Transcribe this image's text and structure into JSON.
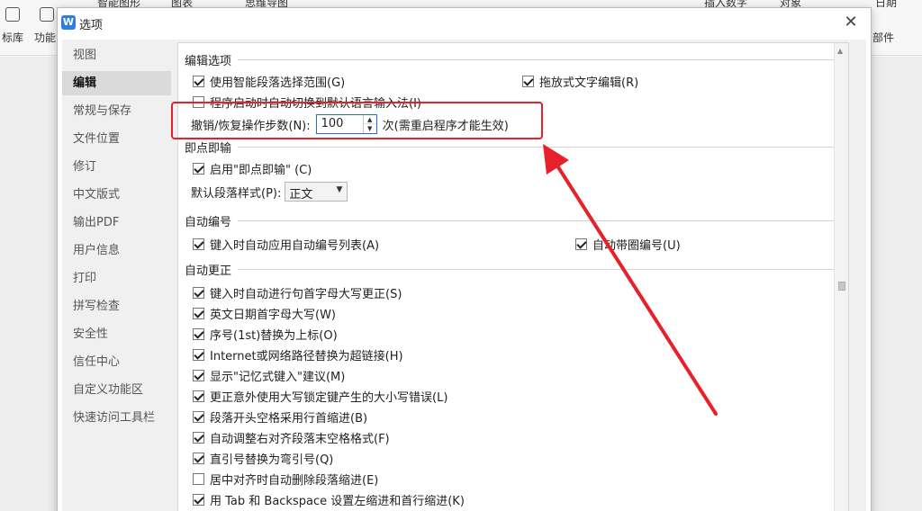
{
  "background": {
    "toolbar_items": [
      "标库",
      "功能",
      "智能图形",
      "图表",
      "思维导图",
      "插入数字",
      "对象",
      "日期",
      "部件"
    ]
  },
  "dialog": {
    "title": "选项",
    "logo_letter": "W",
    "close_symbol": "✕"
  },
  "sidebar": {
    "items": [
      {
        "label": "视图",
        "active": false
      },
      {
        "label": "编辑",
        "active": true
      },
      {
        "label": "常规与保存",
        "active": false
      },
      {
        "label": "文件位置",
        "active": false
      },
      {
        "label": "修订",
        "active": false
      },
      {
        "label": "中文版式",
        "active": false
      },
      {
        "label": "输出PDF",
        "active": false
      },
      {
        "label": "用户信息",
        "active": false
      },
      {
        "label": "打印",
        "active": false
      },
      {
        "label": "拼写检查",
        "active": false
      },
      {
        "label": "安全性",
        "active": false
      },
      {
        "label": "信任中心",
        "active": false
      },
      {
        "label": "自定义功能区",
        "active": false
      },
      {
        "label": "快速访问工具栏",
        "active": false
      }
    ]
  },
  "edit_options": {
    "header": "编辑选项",
    "smart_paragraph": {
      "label": "使用智能段落选择范围(G)",
      "checked": true
    },
    "drag_drop": {
      "label": "拖放式文字编辑(R)",
      "checked": true
    },
    "auto_ime": {
      "label": "程序启动时自动切换到默认语言输入法(I)",
      "checked": false
    },
    "undo_label": "撤销/恢复操作步数(N):",
    "undo_value": "100",
    "undo_suffix": "次(需重启程序才能生效)"
  },
  "click_type": {
    "header": "即点即输",
    "enable": {
      "label": "启用\"即点即输\" (C)",
      "checked": true
    },
    "default_style_label": "默认段落样式(P):",
    "default_style_value": "正文"
  },
  "auto_numbering": {
    "header": "自动编号",
    "auto_list": {
      "label": "键入时自动应用自动编号列表(A)",
      "checked": true
    },
    "circled": {
      "label": "自动带圈编号(U)",
      "checked": true
    }
  },
  "auto_correct": {
    "header": "自动更正",
    "items": [
      {
        "label": "键入时自动进行句首字母大写更正(S)",
        "checked": true
      },
      {
        "label": "英文日期首字母大写(W)",
        "checked": true
      },
      {
        "label": "序号(1st)替换为上标(O)",
        "checked": true
      },
      {
        "label": "Internet或网络路径替换为超链接(H)",
        "checked": true
      },
      {
        "label": "显示\"记忆式键入\"建议(M)",
        "checked": true
      },
      {
        "label": "更正意外使用大写锁定键产生的大小写错误(L)",
        "checked": true
      },
      {
        "label": "段落开头空格采用行首缩进(B)",
        "checked": true
      },
      {
        "label": "自动调整右对齐段落末空格格式(F)",
        "checked": true
      },
      {
        "label": "直引号替换为弯引号(Q)",
        "checked": true
      },
      {
        "label": "居中对齐时自动删除段落缩进(E)",
        "checked": false
      },
      {
        "label": "用 Tab 和 Backspace 设置左缩进和首行缩进(K)",
        "checked": true
      }
    ]
  },
  "annotation_color": "#e8202a"
}
